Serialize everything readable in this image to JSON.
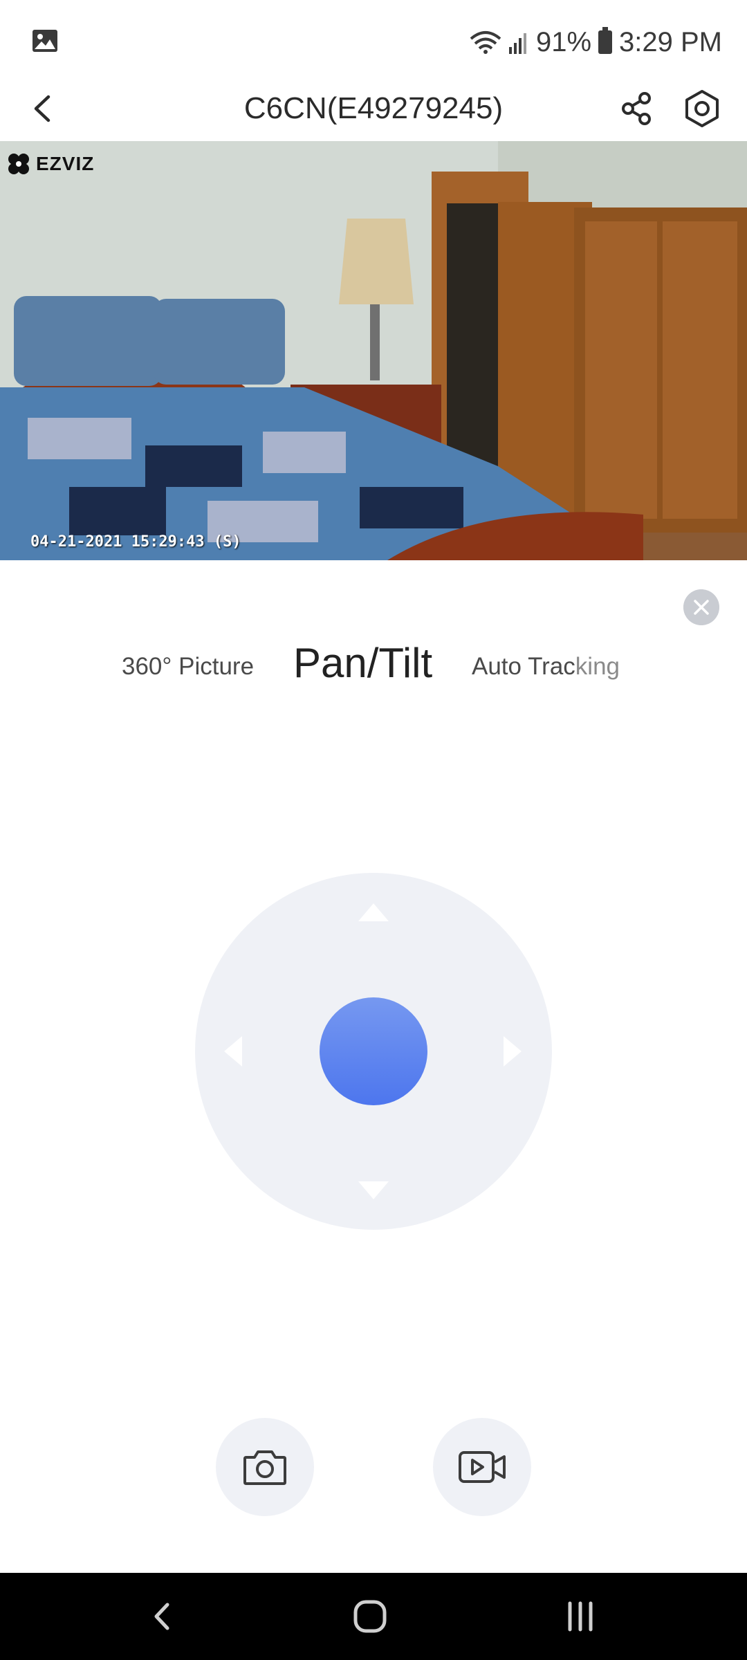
{
  "status_bar": {
    "battery": "91%",
    "time": "3:29 PM"
  },
  "header": {
    "title": "C6CN(E49279245)"
  },
  "video": {
    "logo": "EZVIZ",
    "timestamp": "04-21-2021 15:29:43  (S)"
  },
  "modes": {
    "tab_360": "360° Picture",
    "tab_pan_tilt": "Pan/Tilt",
    "tab_auto_a": "Auto Trac",
    "tab_auto_b": "king"
  },
  "colors": {
    "accent": "#4d76ee",
    "control_bg": "#eff1f6"
  }
}
